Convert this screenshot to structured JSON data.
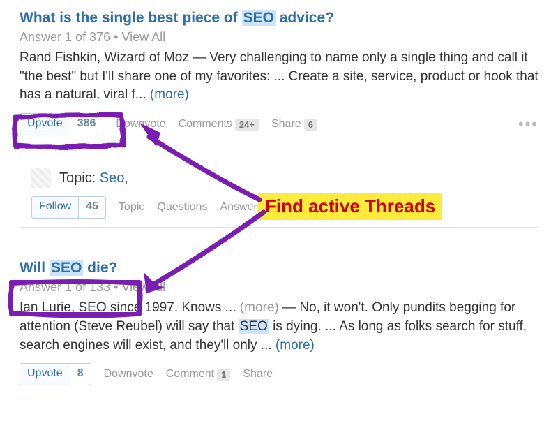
{
  "post1": {
    "title_pre": "What is the single best piece of ",
    "title_hl": "SEO",
    "title_post": " advice?",
    "meta": "Answer 1 of 376",
    "dot": " • ",
    "viewall": "View All",
    "author": "Rand Fishkin",
    "author_desc": ", Wizard of Moz  —  ",
    "body": "Very challenging to name only a single thing and call it \"the best\" but I'll share one of my favorites: ... Create a site, service, product or hook that has a natural, viral f... ",
    "more": "(more)",
    "upvote_label": "Upvote",
    "upvote_count": "386",
    "downvote": "Downvote",
    "comments": "Comments",
    "comments_count": "24+",
    "share": "Share",
    "share_count": "6"
  },
  "topic_card": {
    "label": "Topic: ",
    "name": "Seo,",
    "follow_label": "Follow",
    "follow_count": "45",
    "link_topic": "Topic",
    "link_questions": "Questions",
    "link_answers": "Answers"
  },
  "post2": {
    "title_pre": "Will ",
    "title_hl": "SEO",
    "title_post": " die?",
    "meta": "Answer 1 of 133",
    "dot": " • ",
    "viewall": "View All",
    "author": "Ian Lurie",
    "author_desc": ", SEO since 1997. Knows ... ",
    "author_more": "(more)",
    "body_dash": "  —  ",
    "body": "No, it won't. Only pundits begging for attention (Steve Reubel) will say that ",
    "body_hl": "SEO",
    "body2": " is dying. ... As long as folks search for stuff, search engines will exist, and they'll only ... ",
    "more": "(more)",
    "upvote_label": "Upvote",
    "upvote_count": "8",
    "downvote": "Downvote",
    "comment": "Comment",
    "comment_count": "1",
    "share": "Share"
  },
  "annotation": "Find active Threads"
}
